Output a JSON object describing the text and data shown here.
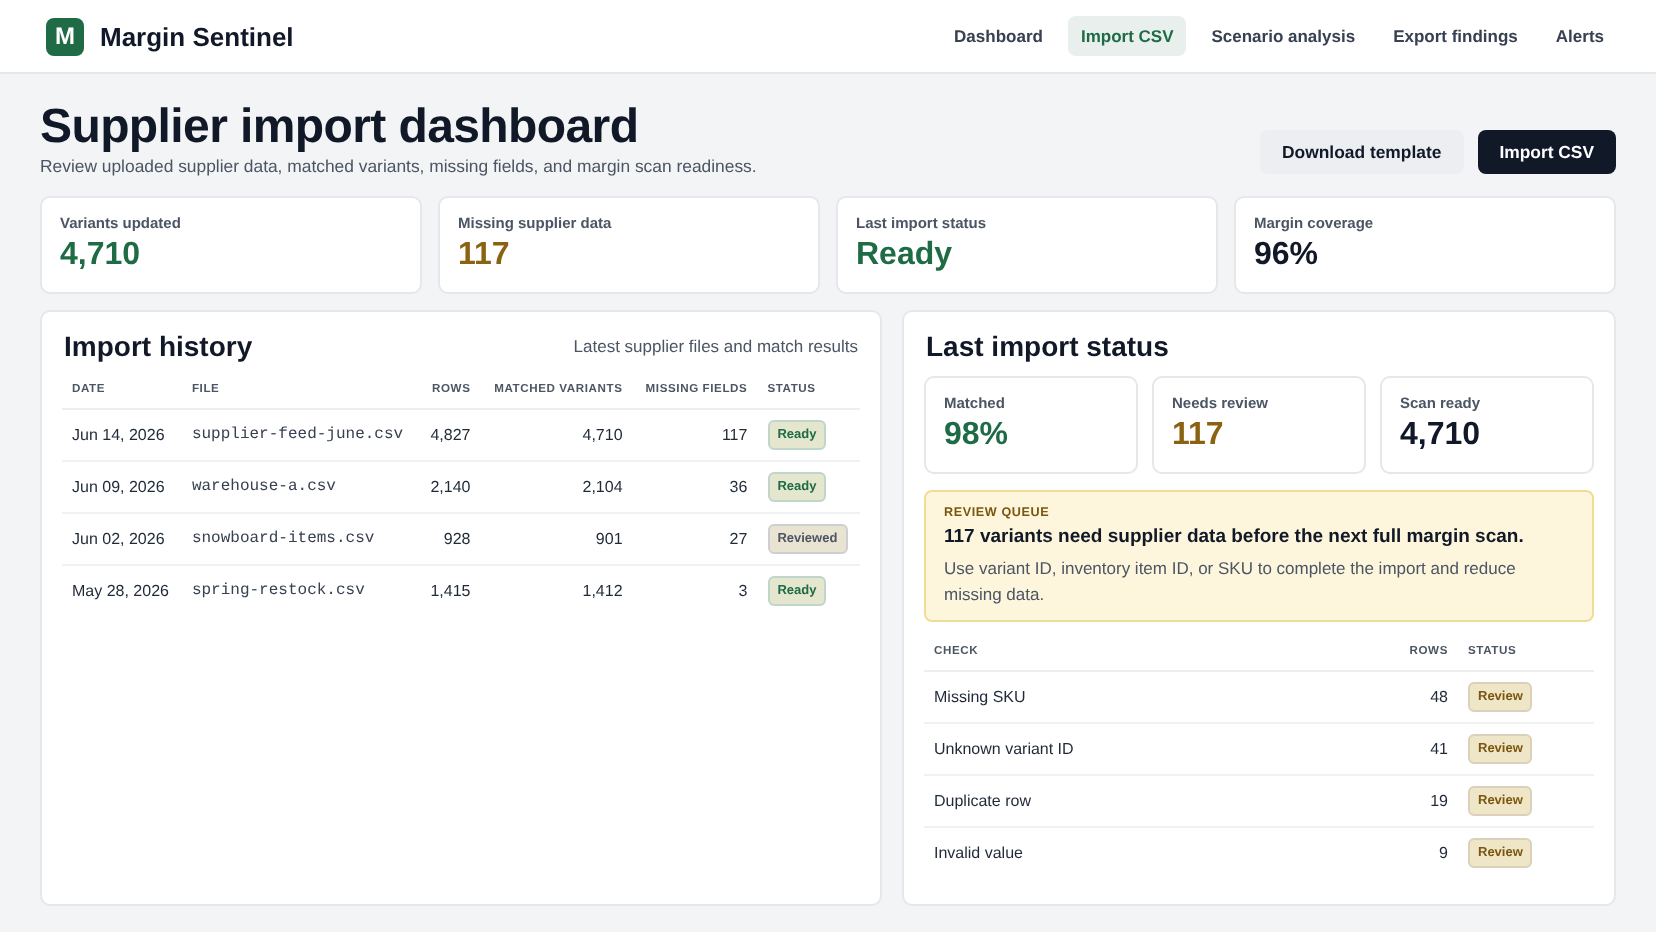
{
  "app": {
    "logo_letter": "M",
    "name": "Margin Sentinel"
  },
  "nav": [
    {
      "label": "Dashboard",
      "selected": false
    },
    {
      "label": "Import CSV",
      "selected": true
    },
    {
      "label": "Scenario analysis",
      "selected": false
    },
    {
      "label": "Export findings",
      "selected": false
    },
    {
      "label": "Alerts",
      "selected": false
    }
  ],
  "page": {
    "title": "Supplier import dashboard",
    "subtitle": "Review uploaded supplier data, matched variants, missing fields, and margin scan readiness.",
    "buttons": [
      {
        "label": "Download template",
        "kind": "secondary"
      },
      {
        "label": "Import CSV",
        "kind": "primary"
      }
    ]
  },
  "stats": [
    {
      "label": "Variants updated",
      "value": "4,710",
      "color": "#1e6b45"
    },
    {
      "label": "Missing supplier data",
      "value": "117",
      "color": "#8a6212"
    },
    {
      "label": "Last import status",
      "value": "Ready",
      "color": "#1e6b45"
    },
    {
      "label": "Margin coverage",
      "value": "96%",
      "color": "#111827"
    }
  ],
  "import_history": {
    "title": "Import history",
    "note": "Latest supplier files and match results",
    "columns": [
      "DATE",
      "FILE",
      "ROWS",
      "MATCHED VARIANTS",
      "MISSING FIELDS",
      "STATUS"
    ],
    "rows": [
      {
        "date": "Jun 14, 2026",
        "file": "supplier-feed-june.csv",
        "rows": "4,827",
        "matched": "4,710",
        "missing": "117",
        "status": "Ready",
        "color": "#1e6b45"
      },
      {
        "date": "Jun 09, 2026",
        "file": "warehouse-a.csv",
        "rows": "2,140",
        "matched": "2,104",
        "missing": "36",
        "status": "Ready",
        "color": "#1e6b45"
      },
      {
        "date": "Jun 02, 2026",
        "file": "snowboard-items.csv",
        "rows": "928",
        "matched": "901",
        "missing": "27",
        "status": "Reviewed",
        "color": "#4b5563"
      },
      {
        "date": "May 28, 2026",
        "file": "spring-restock.csv",
        "rows": "1,415",
        "matched": "1,412",
        "missing": "3",
        "status": "Ready",
        "color": "#1e6b45"
      }
    ]
  },
  "last_import": {
    "title": "Last import status",
    "metrics": [
      {
        "label": "Matched",
        "value": "98%",
        "color": "#1e6b45"
      },
      {
        "label": "Needs review",
        "value": "117",
        "color": "#8a6212"
      },
      {
        "label": "Scan ready",
        "value": "4,710",
        "color": "#111827"
      }
    ],
    "queue": {
      "eyebrow": "REVIEW QUEUE",
      "heading": "117 variants need supplier data before the next full margin scan.",
      "body": "Use variant ID, inventory item ID, or SKU to complete the import and reduce missing data."
    },
    "columns": [
      "CHECK",
      "ROWS",
      "STATUS"
    ],
    "checks": [
      {
        "check": "Missing SKU",
        "rows": "48",
        "status": "Review",
        "color": "#7a560f"
      },
      {
        "check": "Unknown variant ID",
        "rows": "41",
        "status": "Review",
        "color": "#7a560f"
      },
      {
        "check": "Duplicate row",
        "rows": "19",
        "status": "Review",
        "color": "#7a560f"
      },
      {
        "check": "Invalid value",
        "rows": "9",
        "status": "Review",
        "color": "#7a560f"
      }
    ]
  }
}
